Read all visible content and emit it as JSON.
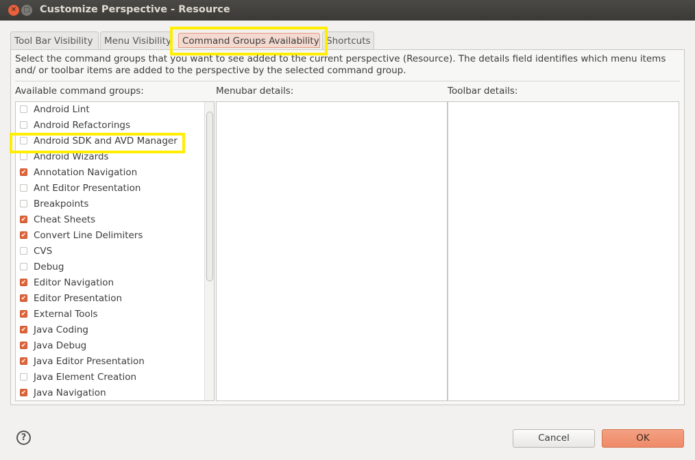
{
  "window": {
    "title": "Customize Perspective - Resource"
  },
  "tabs": [
    {
      "label": "Tool Bar Visibility"
    },
    {
      "label": "Menu Visibility"
    },
    {
      "label": "Command Groups Availability",
      "active": true
    },
    {
      "label": "Shortcuts"
    }
  ],
  "description": "Select the command groups that you want to see added to the current perspective (Resource).  The details field identifies which menu items and/ or toolbar items are added to the perspective by the selected command group.",
  "labels": {
    "available": "Available command groups:",
    "menubar": "Menubar details:",
    "toolbar": "Toolbar details:"
  },
  "groups": [
    {
      "label": "Android Lint",
      "checked": false
    },
    {
      "label": "Android Refactorings",
      "checked": false
    },
    {
      "label": "Android SDK and AVD Manager",
      "checked": false
    },
    {
      "label": "Android Wizards",
      "checked": false
    },
    {
      "label": "Annotation Navigation",
      "checked": true
    },
    {
      "label": "Ant Editor Presentation",
      "checked": false
    },
    {
      "label": "Breakpoints",
      "checked": false
    },
    {
      "label": "Cheat Sheets",
      "checked": true
    },
    {
      "label": "Convert Line Delimiters",
      "checked": true
    },
    {
      "label": "CVS",
      "checked": false
    },
    {
      "label": "Debug",
      "checked": false
    },
    {
      "label": "Editor Navigation",
      "checked": true
    },
    {
      "label": "Editor Presentation",
      "checked": true
    },
    {
      "label": "External Tools",
      "checked": true
    },
    {
      "label": "Java Coding",
      "checked": true
    },
    {
      "label": "Java Debug",
      "checked": true
    },
    {
      "label": "Java Editor Presentation",
      "checked": true
    },
    {
      "label": "Java Element Creation",
      "checked": false
    },
    {
      "label": "Java Navigation",
      "checked": true
    }
  ],
  "buttons": {
    "help": "?",
    "cancel": "Cancel",
    "ok": "OK"
  }
}
